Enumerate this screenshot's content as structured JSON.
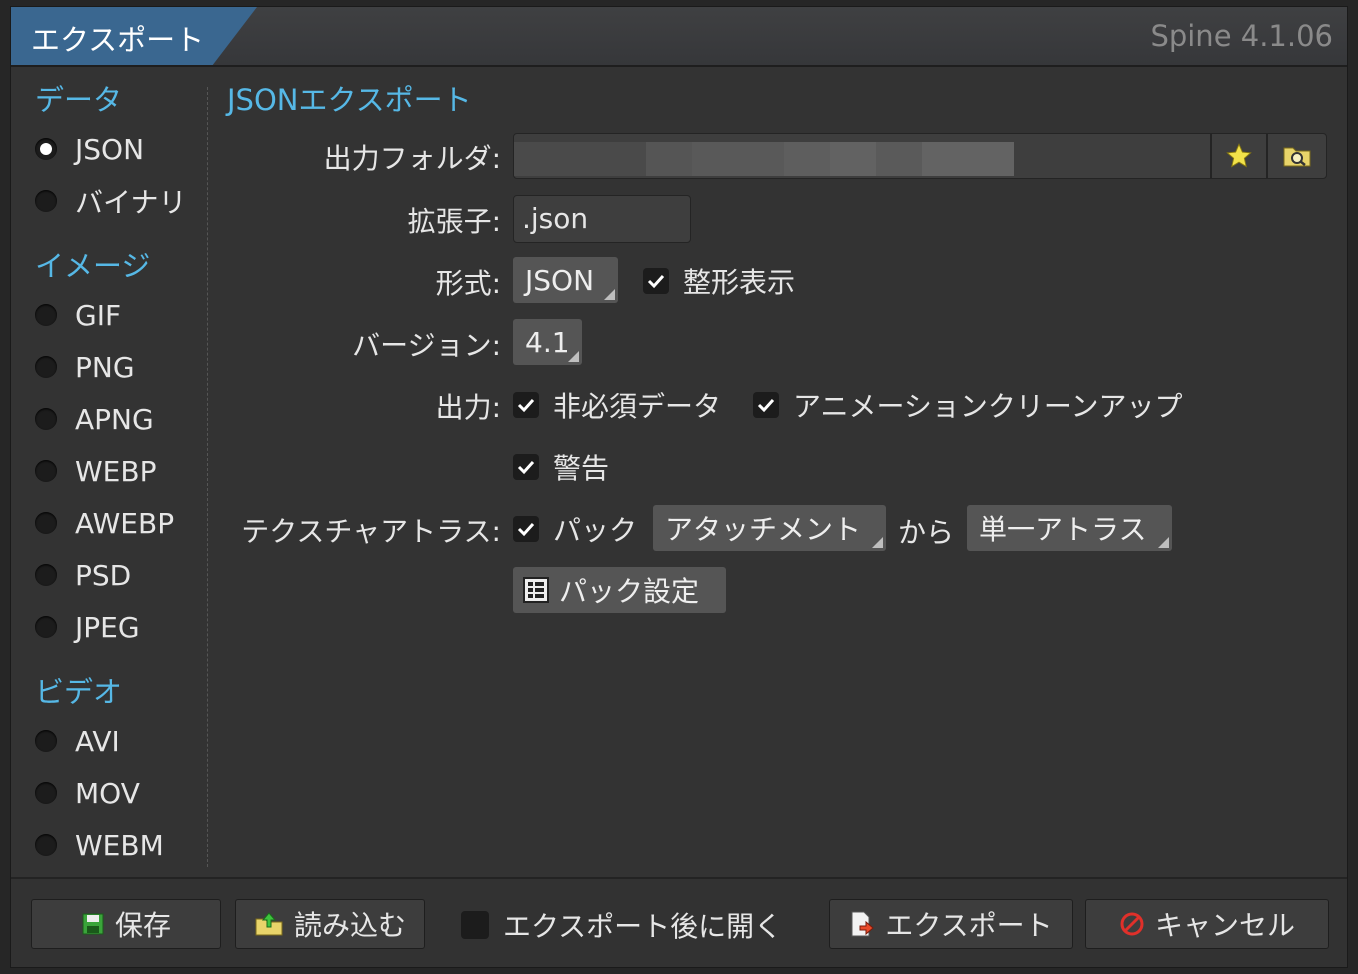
{
  "window": {
    "title": "エクスポート",
    "version": "Spine 4.1.06"
  },
  "sidebar": {
    "sections": [
      {
        "label": "データ",
        "items": [
          {
            "label": "JSON",
            "selected": true
          },
          {
            "label": "バイナリ",
            "selected": false
          }
        ]
      },
      {
        "label": "イメージ",
        "items": [
          {
            "label": "GIF"
          },
          {
            "label": "PNG"
          },
          {
            "label": "APNG"
          },
          {
            "label": "WEBP"
          },
          {
            "label": "AWEBP"
          },
          {
            "label": "PSD"
          },
          {
            "label": "JPEG"
          }
        ]
      },
      {
        "label": "ビデオ",
        "items": [
          {
            "label": "AVI"
          },
          {
            "label": "MOV"
          },
          {
            "label": "WEBM"
          }
        ]
      }
    ]
  },
  "main": {
    "heading": "JSONエクスポート",
    "output_folder": {
      "label": "出力フォルダ:",
      "value": ""
    },
    "extension": {
      "label": "拡張子:",
      "value": ".json"
    },
    "format": {
      "label": "形式:",
      "value": "JSON",
      "pretty_print": {
        "label": "整形表示",
        "checked": true
      }
    },
    "version": {
      "label": "バージョン:",
      "value": "4.1"
    },
    "output": {
      "label": "出力:",
      "nonessential": {
        "label": "非必須データ",
        "checked": true
      },
      "animation_cleanup": {
        "label": "アニメーションクリーンアップ",
        "checked": true
      },
      "warnings": {
        "label": "警告",
        "checked": true
      }
    },
    "texture_atlas": {
      "label": "テクスチャアトラス:",
      "pack": {
        "label": "パック",
        "checked": true
      },
      "source": "アタッチメント",
      "from_label": "から",
      "target": "単一アトラス",
      "pack_settings": "パック設定"
    }
  },
  "footer": {
    "save": "保存",
    "load": "読み込む",
    "open_after": {
      "label": "エクスポート後に開く",
      "checked": false
    },
    "export": "エクスポート",
    "cancel": "キャンセル"
  },
  "colors": {
    "accent": "#56b8e6",
    "title_tab": "#3a6790",
    "background": "#333333"
  }
}
